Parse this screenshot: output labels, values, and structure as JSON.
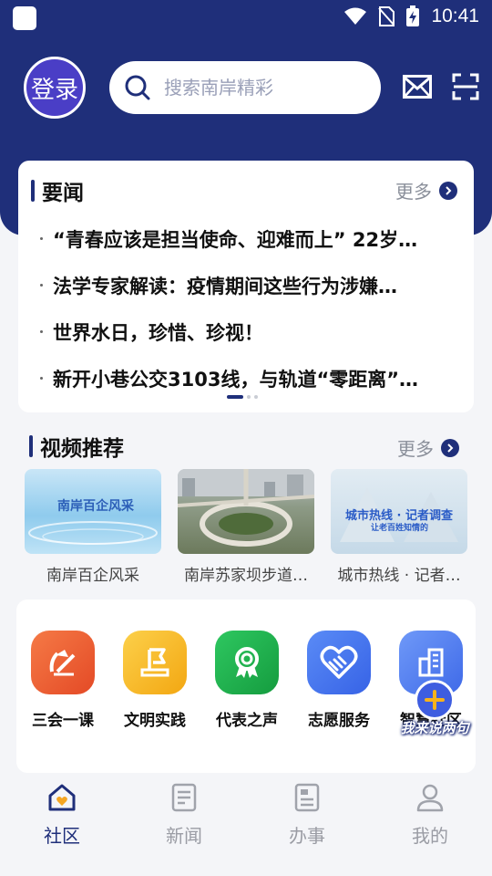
{
  "status_bar": {
    "time": "10:41"
  },
  "header": {
    "login_label": "登录",
    "search_placeholder": "搜索南岸精彩"
  },
  "news": {
    "title": "要闻",
    "more": "更多",
    "items": [
      "“青春应该是担当使命、迎难而上” 22岁…",
      "法学专家解读：疫情期间这些行为涉嫌…",
      "世界水日，珍惜、珍视！",
      "新开小巷公交3103线，与轨道“零距离”…"
    ],
    "page": 1,
    "page_count": 3
  },
  "videos": {
    "title": "视频推荐",
    "more": "更多",
    "items": [
      {
        "caption": "南岸百企风采",
        "thumb_text": "南岸百企风采"
      },
      {
        "caption": "南岸苏家坝步道…",
        "thumb_text": ""
      },
      {
        "caption": "城市热线 · 记者…",
        "thumb_text": "城市热线 · 记者调查",
        "thumb_sub": "让老百姓知情的"
      }
    ]
  },
  "services": [
    {
      "label": "三会一课",
      "icon": "party-emblem-icon",
      "color": "#ef5a32"
    },
    {
      "label": "文明实践",
      "icon": "flag-icon",
      "color": "#f5b21c"
    },
    {
      "label": "代表之声",
      "icon": "badge-icon",
      "color": "#1fae4b"
    },
    {
      "label": "志愿服务",
      "icon": "heart-hands-icon",
      "color": "#3f6df0"
    },
    {
      "label": "智慧社区",
      "icon": "building-icon",
      "color": "#4d7df2"
    }
  ],
  "fab": {
    "label": "我来说两句"
  },
  "tabs": [
    {
      "label": "社区",
      "icon": "home-icon",
      "active": true
    },
    {
      "label": "新闻",
      "icon": "news-icon",
      "active": false
    },
    {
      "label": "办事",
      "icon": "tasks-icon",
      "active": false
    },
    {
      "label": "我的",
      "icon": "user-icon",
      "active": false
    }
  ],
  "colors": {
    "brand": "#1f2f7a",
    "background": "#f4f5f8"
  }
}
